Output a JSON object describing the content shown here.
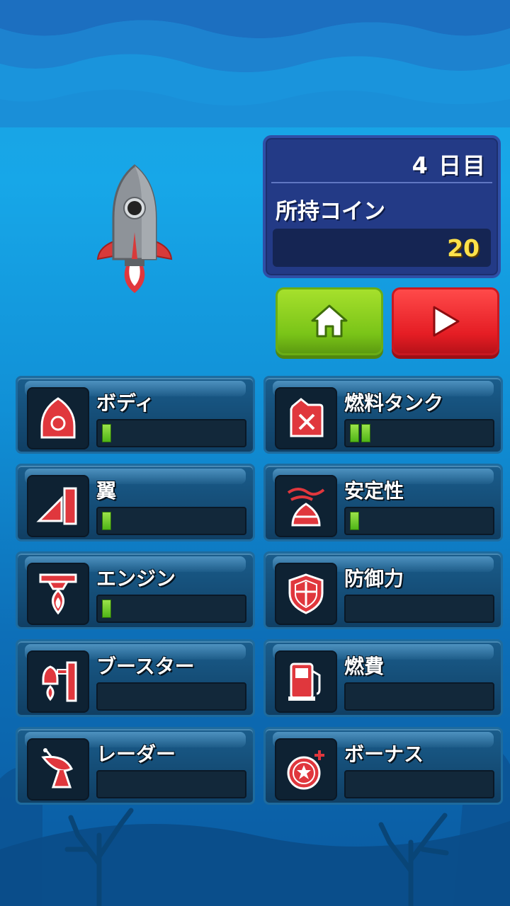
{
  "status": {
    "day_label": "4 日目",
    "coin_label": "所持コイン",
    "coin_value": "20"
  },
  "buttons": {
    "home_icon": "home-icon",
    "play_icon": "play-icon"
  },
  "upgrades": [
    {
      "label": "ボディ",
      "icon": "rocket-body-icon",
      "level": 1
    },
    {
      "label": "燃料タンク",
      "icon": "fuel-tank-icon",
      "level": 2
    },
    {
      "label": "翼",
      "icon": "wing-icon",
      "level": 1
    },
    {
      "label": "安定性",
      "icon": "stability-icon",
      "level": 1
    },
    {
      "label": "エンジン",
      "icon": "engine-icon",
      "level": 1
    },
    {
      "label": "防御力",
      "icon": "shield-icon",
      "level": 0
    },
    {
      "label": "ブースター",
      "icon": "booster-icon",
      "level": 0
    },
    {
      "label": "燃費",
      "icon": "fuel-pump-icon",
      "level": 0
    },
    {
      "label": "レーダー",
      "icon": "radar-icon",
      "level": 0
    },
    {
      "label": "ボーナス",
      "icon": "bonus-coin-icon",
      "level": 0
    }
  ],
  "colors": {
    "accent_green": "#7ac418",
    "accent_red": "#e51d24",
    "coin_text": "#ffe24a",
    "icon_red": "#e0373d"
  }
}
